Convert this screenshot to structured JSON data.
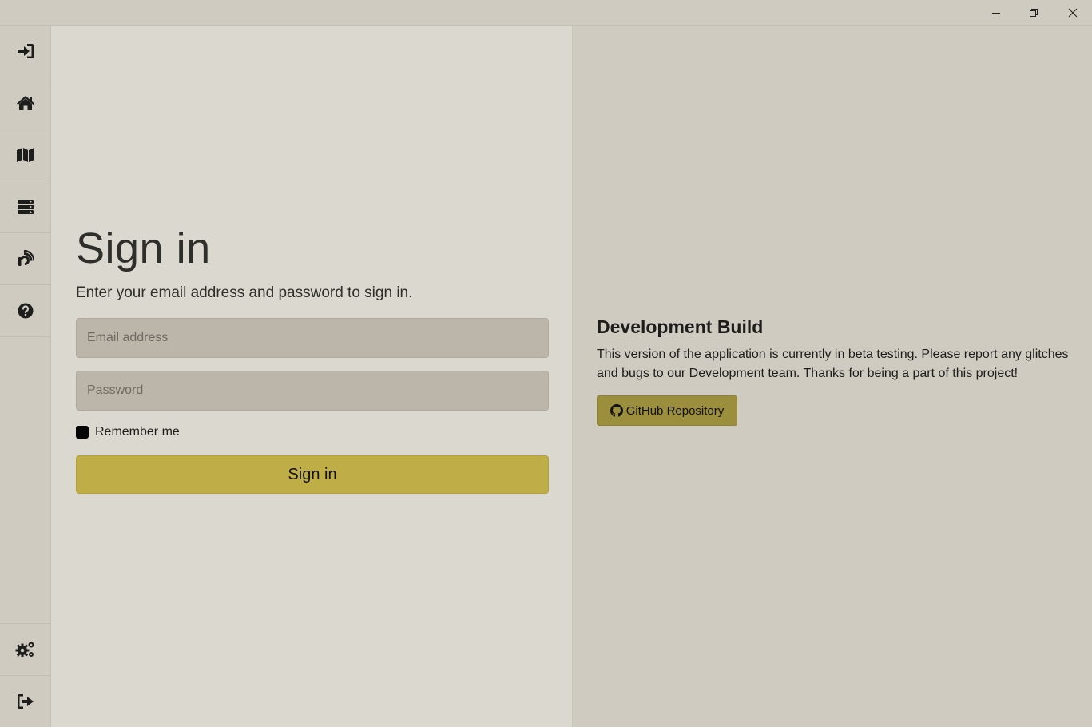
{
  "window": {
    "controls": [
      "minimize",
      "restore",
      "close"
    ]
  },
  "sidebar": {
    "items": [
      {
        "icon": "sign-in-icon"
      },
      {
        "icon": "home-icon"
      },
      {
        "icon": "map-icon"
      },
      {
        "icon": "server-icon"
      },
      {
        "icon": "feed-icon"
      },
      {
        "icon": "help-icon"
      }
    ],
    "bottom_items": [
      {
        "icon": "settings-icon"
      },
      {
        "icon": "sign-out-icon"
      }
    ]
  },
  "signin": {
    "title": "Sign in",
    "subtitle": "Enter your email address and password to sign in.",
    "email_placeholder": "Email address",
    "password_placeholder": "Password",
    "remember_label": "Remember me",
    "button_label": "Sign in"
  },
  "info": {
    "title": "Development Build",
    "text": "This version of the application is currently in beta testing. Please report any glitches and bugs to our Development team. Thanks for being a part of this project!",
    "github_label": "GitHub Repository"
  },
  "colors": {
    "accent": "#bfad48",
    "github_button": "#9b8e3c",
    "sidebar_bg": "#d0cbc0",
    "main_bg": "#dbd8cf",
    "field_bg": "#bcb6aa"
  }
}
